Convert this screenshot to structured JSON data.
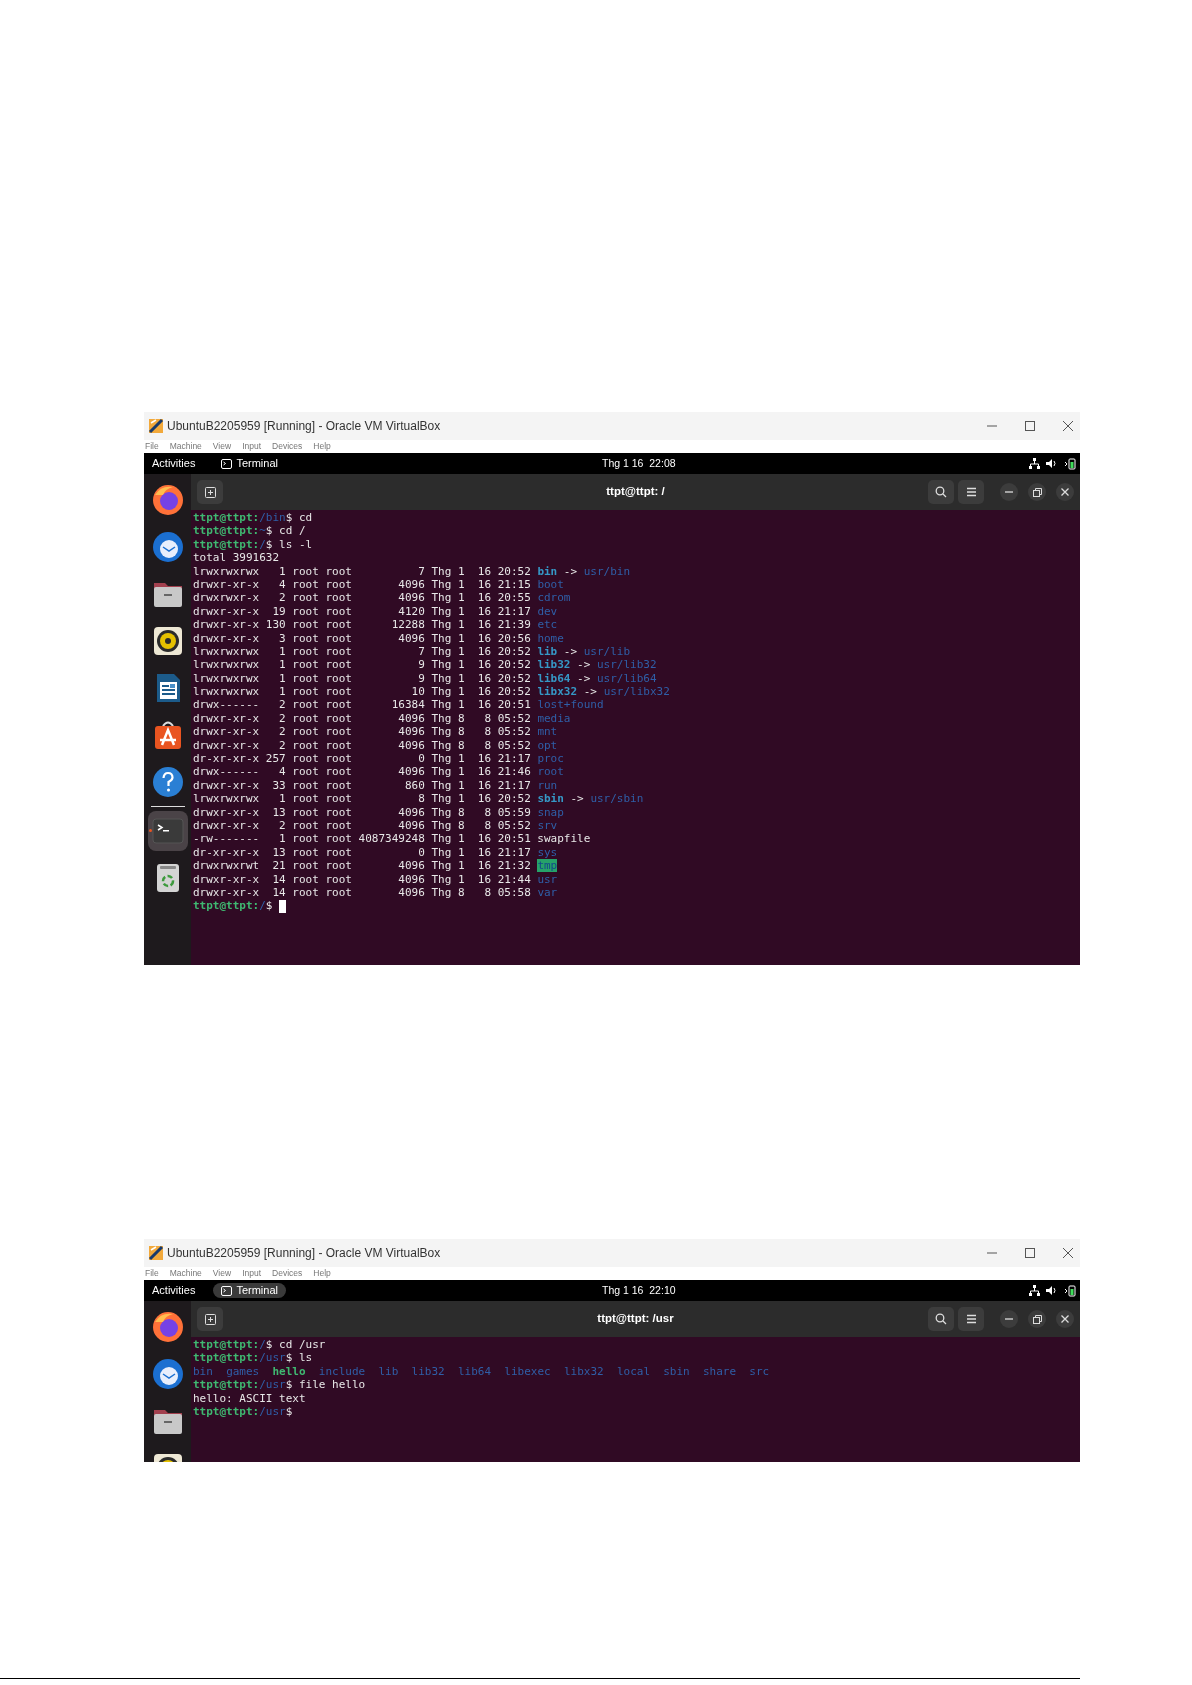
{
  "windows": [
    {
      "title": "UbuntuB2205959 [Running] - Oracle VM VirtualBox",
      "menu": [
        "File",
        "Machine",
        "View",
        "Input",
        "Devices",
        "Help"
      ],
      "topbar": {
        "activities": "Activities",
        "app": "Terminal",
        "app_selected": false,
        "clock": "Thg 1 16  22:08"
      },
      "dock": [
        {
          "kind": "firefox",
          "selected": false
        },
        {
          "kind": "thunderbird",
          "selected": false
        },
        {
          "kind": "files",
          "selected": false
        },
        {
          "kind": "rhythmbox",
          "selected": false
        },
        {
          "kind": "writer",
          "selected": false
        },
        {
          "kind": "appstore",
          "selected": false
        },
        {
          "kind": "help",
          "selected": false
        },
        {
          "kind": "separator"
        },
        {
          "kind": "terminal",
          "selected": true
        },
        {
          "kind": "trash",
          "selected": false
        }
      ],
      "terminal_title": "ttpt@ttpt: /",
      "lines": [
        {
          "cursor": false,
          "segments": [
            {
              "kind": "user",
              "t": "ttpt@ttpt:"
            },
            {
              "kind": "path",
              "t": "/bin"
            },
            {
              "kind": "text",
              "t": "$ cd"
            }
          ]
        },
        {
          "cursor": false,
          "segments": [
            {
              "kind": "user",
              "t": "ttpt@ttpt:"
            },
            {
              "kind": "path",
              "t": "~"
            },
            {
              "kind": "text",
              "t": "$ cd /"
            }
          ]
        },
        {
          "cursor": false,
          "segments": [
            {
              "kind": "user",
              "t": "ttpt@ttpt:"
            },
            {
              "kind": "path",
              "t": "/"
            },
            {
              "kind": "text",
              "t": "$ ls -l"
            }
          ]
        },
        {
          "cursor": false,
          "segments": [
            {
              "kind": "text",
              "t": "total 3991632"
            }
          ]
        },
        {
          "cursor": false,
          "segments": [
            {
              "kind": "text",
              "t": "lrwxrwxrwx   1 root root          7 Thg 1  16 20:52 "
            },
            {
              "kind": "link",
              "t": "bin"
            },
            {
              "kind": "text",
              "t": " -> "
            },
            {
              "kind": "dir",
              "t": "usr/bin"
            }
          ]
        },
        {
          "cursor": false,
          "segments": [
            {
              "kind": "text",
              "t": "drwxr-xr-x   4 root root       4096 Thg 1  16 21:15 "
            },
            {
              "kind": "dir",
              "t": "boot"
            }
          ]
        },
        {
          "cursor": false,
          "segments": [
            {
              "kind": "text",
              "t": "drwxrwxr-x   2 root root       4096 Thg 1  16 20:55 "
            },
            {
              "kind": "dir",
              "t": "cdrom"
            }
          ]
        },
        {
          "cursor": false,
          "segments": [
            {
              "kind": "text",
              "t": "drwxr-xr-x  19 root root       4120 Thg 1  16 21:17 "
            },
            {
              "kind": "dir",
              "t": "dev"
            }
          ]
        },
        {
          "cursor": false,
          "segments": [
            {
              "kind": "text",
              "t": "drwxr-xr-x 130 root root      12288 Thg 1  16 21:39 "
            },
            {
              "kind": "dir",
              "t": "etc"
            }
          ]
        },
        {
          "cursor": false,
          "segments": [
            {
              "kind": "text",
              "t": "drwxr-xr-x   3 root root       4096 Thg 1  16 20:56 "
            },
            {
              "kind": "dir",
              "t": "home"
            }
          ]
        },
        {
          "cursor": false,
          "segments": [
            {
              "kind": "text",
              "t": "lrwxrwxrwx   1 root root          7 Thg 1  16 20:52 "
            },
            {
              "kind": "link",
              "t": "lib"
            },
            {
              "kind": "text",
              "t": " -> "
            },
            {
              "kind": "dir",
              "t": "usr/lib"
            }
          ]
        },
        {
          "cursor": false,
          "segments": [
            {
              "kind": "text",
              "t": "lrwxrwxrwx   1 root root          9 Thg 1  16 20:52 "
            },
            {
              "kind": "link",
              "t": "lib32"
            },
            {
              "kind": "text",
              "t": " -> "
            },
            {
              "kind": "dir",
              "t": "usr/lib32"
            }
          ]
        },
        {
          "cursor": false,
          "segments": [
            {
              "kind": "text",
              "t": "lrwxrwxrwx   1 root root          9 Thg 1  16 20:52 "
            },
            {
              "kind": "link",
              "t": "lib64"
            },
            {
              "kind": "text",
              "t": " -> "
            },
            {
              "kind": "dir",
              "t": "usr/lib64"
            }
          ]
        },
        {
          "cursor": false,
          "segments": [
            {
              "kind": "text",
              "t": "lrwxrwxrwx   1 root root         10 Thg 1  16 20:52 "
            },
            {
              "kind": "link",
              "t": "libx32"
            },
            {
              "kind": "text",
              "t": " -> "
            },
            {
              "kind": "dir",
              "t": "usr/libx32"
            }
          ]
        },
        {
          "cursor": false,
          "segments": [
            {
              "kind": "text",
              "t": "drwx------   2 root root      16384 Thg 1  16 20:51 "
            },
            {
              "kind": "dir",
              "t": "lost+found"
            }
          ]
        },
        {
          "cursor": false,
          "segments": [
            {
              "kind": "text",
              "t": "drwxr-xr-x   2 root root       4096 Thg 8   8 05:52 "
            },
            {
              "kind": "dir",
              "t": "media"
            }
          ]
        },
        {
          "cursor": false,
          "segments": [
            {
              "kind": "text",
              "t": "drwxr-xr-x   2 root root       4096 Thg 8   8 05:52 "
            },
            {
              "kind": "dir",
              "t": "mnt"
            }
          ]
        },
        {
          "cursor": false,
          "segments": [
            {
              "kind": "text",
              "t": "drwxr-xr-x   2 root root       4096 Thg 8   8 05:52 "
            },
            {
              "kind": "dir",
              "t": "opt"
            }
          ]
        },
        {
          "cursor": false,
          "segments": [
            {
              "kind": "text",
              "t": "dr-xr-xr-x 257 root root          0 Thg 1  16 21:17 "
            },
            {
              "kind": "dir",
              "t": "proc"
            }
          ]
        },
        {
          "cursor": false,
          "segments": [
            {
              "kind": "text",
              "t": "drwx------   4 root root       4096 Thg 1  16 21:46 "
            },
            {
              "kind": "dir",
              "t": "root"
            }
          ]
        },
        {
          "cursor": false,
          "segments": [
            {
              "kind": "text",
              "t": "drwxr-xr-x  33 root root        860 Thg 1  16 21:17 "
            },
            {
              "kind": "dir",
              "t": "run"
            }
          ]
        },
        {
          "cursor": false,
          "segments": [
            {
              "kind": "text",
              "t": "lrwxrwxrwx   1 root root          8 Thg 1  16 20:52 "
            },
            {
              "kind": "link",
              "t": "sbin"
            },
            {
              "kind": "text",
              "t": " -> "
            },
            {
              "kind": "dir",
              "t": "usr/sbin"
            }
          ]
        },
        {
          "cursor": false,
          "segments": [
            {
              "kind": "text",
              "t": "drwxr-xr-x  13 root root       4096 Thg 8   8 05:59 "
            },
            {
              "kind": "dir",
              "t": "snap"
            }
          ]
        },
        {
          "cursor": false,
          "segments": [
            {
              "kind": "text",
              "t": "drwxr-xr-x   2 root root       4096 Thg 8   8 05:52 "
            },
            {
              "kind": "dir",
              "t": "srv"
            }
          ]
        },
        {
          "cursor": false,
          "segments": [
            {
              "kind": "text",
              "t": "-rw-------   1 root root 4087349248 Thg 1  16 20:51 swapfile"
            }
          ]
        },
        {
          "cursor": false,
          "segments": [
            {
              "kind": "text",
              "t": "dr-xr-xr-x  13 root root          0 Thg 1  16 21:17 "
            },
            {
              "kind": "dir",
              "t": "sys"
            }
          ]
        },
        {
          "cursor": false,
          "segments": [
            {
              "kind": "text",
              "t": "drwxrwxrwt  21 root root       4096 Thg 1  16 21:32 "
            },
            {
              "kind": "sticky",
              "t": "tmp"
            }
          ]
        },
        {
          "cursor": false,
          "segments": [
            {
              "kind": "text",
              "t": "drwxr-xr-x  14 root root       4096 Thg 1  16 21:44 "
            },
            {
              "kind": "dir",
              "t": "usr"
            }
          ]
        },
        {
          "cursor": false,
          "segments": [
            {
              "kind": "text",
              "t": "drwxr-xr-x  14 root root       4096 Thg 8   8 05:58 "
            },
            {
              "kind": "dir",
              "t": "var"
            }
          ]
        },
        {
          "cursor": true,
          "segments": [
            {
              "kind": "user",
              "t": "ttpt@ttpt:"
            },
            {
              "kind": "path",
              "t": "/"
            },
            {
              "kind": "text",
              "t": "$ "
            }
          ]
        }
      ]
    },
    {
      "title": "UbuntuB2205959 [Running] - Oracle VM VirtualBox",
      "menu": [
        "File",
        "Machine",
        "View",
        "Input",
        "Devices",
        "Help"
      ],
      "topbar": {
        "activities": "Activities",
        "app": "Terminal",
        "app_selected": true,
        "clock": "Thg 1 16  22:10"
      },
      "dock": [
        {
          "kind": "firefox",
          "selected": false
        },
        {
          "kind": "thunderbird",
          "selected": false
        },
        {
          "kind": "files",
          "selected": false
        },
        {
          "kind": "rhythmbox",
          "selected": false
        }
      ],
      "terminal_title": "ttpt@ttpt: /usr",
      "lines": [
        {
          "cursor": false,
          "segments": [
            {
              "kind": "user",
              "t": "ttpt@ttpt:"
            },
            {
              "kind": "path",
              "t": "/"
            },
            {
              "kind": "text",
              "t": "$ cd /usr"
            }
          ]
        },
        {
          "cursor": false,
          "segments": [
            {
              "kind": "user",
              "t": "ttpt@ttpt:"
            },
            {
              "kind": "path",
              "t": "/usr"
            },
            {
              "kind": "text",
              "t": "$ ls"
            }
          ]
        },
        {
          "cursor": false,
          "segments": [
            {
              "kind": "dir",
              "t": "bin  "
            },
            {
              "kind": "dir",
              "t": "games  "
            },
            {
              "kind": "exec",
              "t": "hello  "
            },
            {
              "kind": "dir",
              "t": "include  "
            },
            {
              "kind": "dir",
              "t": "lib  "
            },
            {
              "kind": "dir",
              "t": "lib32  "
            },
            {
              "kind": "dir",
              "t": "lib64  "
            },
            {
              "kind": "dir",
              "t": "libexec  "
            },
            {
              "kind": "dir",
              "t": "libx32  "
            },
            {
              "kind": "dir",
              "t": "local  "
            },
            {
              "kind": "dir",
              "t": "sbin  "
            },
            {
              "kind": "dir",
              "t": "share  "
            },
            {
              "kind": "dir",
              "t": "src"
            }
          ]
        },
        {
          "cursor": false,
          "segments": [
            {
              "kind": "user",
              "t": "ttpt@ttpt:"
            },
            {
              "kind": "path",
              "t": "/usr"
            },
            {
              "kind": "text",
              "t": "$ file hello"
            }
          ]
        },
        {
          "cursor": false,
          "segments": [
            {
              "kind": "text",
              "t": "hello: ASCII text"
            }
          ]
        },
        {
          "cursor": false,
          "segments": [
            {
              "kind": "user",
              "t": "ttpt@ttpt:"
            },
            {
              "kind": "path",
              "t": "/usr"
            },
            {
              "kind": "text",
              "t": "$"
            }
          ]
        }
      ]
    }
  ]
}
